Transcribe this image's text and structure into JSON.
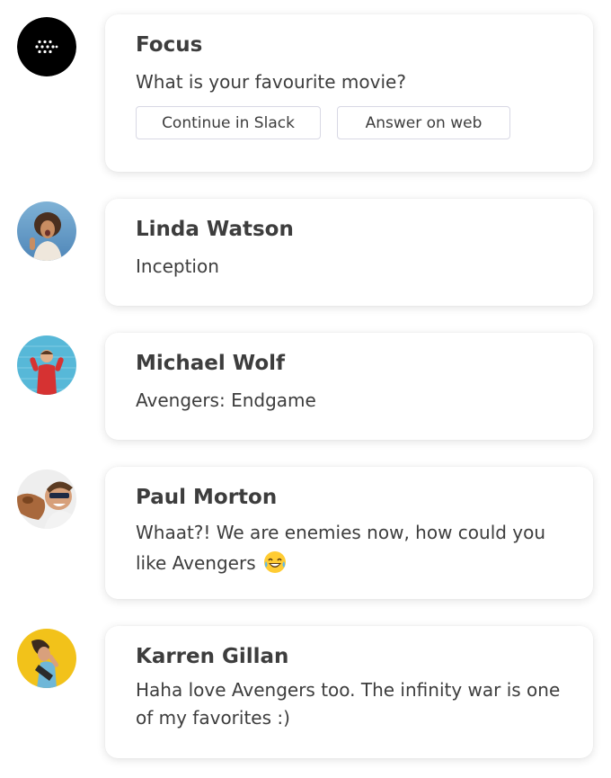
{
  "messages": [
    {
      "sender": "Focus",
      "text": "What is your favourite movie?",
      "avatar_icon": "focus-logo-icon",
      "actions": [
        "Continue in Slack",
        "Answer on web"
      ]
    },
    {
      "sender": "Linda Watson",
      "text": "Inception",
      "avatar_icon": "linda-watson-avatar"
    },
    {
      "sender": "Michael Wolf",
      "text": "Avengers: Endgame",
      "avatar_icon": "michael-wolf-avatar"
    },
    {
      "sender": "Paul Morton",
      "text_line1": "Whaat?! We are enemies now, how could you",
      "text_line2": "like Avengers",
      "emoji": "laughing-tears-emoji",
      "avatar_icon": "paul-morton-avatar"
    },
    {
      "sender": "Karren Gillan",
      "text_line1": "Haha love Avengers too. The infinity war is one",
      "text_line2": "of my favorites :)",
      "avatar_icon": "karren-gillan-avatar"
    }
  ],
  "colors": {
    "card_bg": "#ffffff",
    "text": "#3d3d3d",
    "button_border": "#d8d8e4",
    "focus_logo_bg": "#000000"
  }
}
